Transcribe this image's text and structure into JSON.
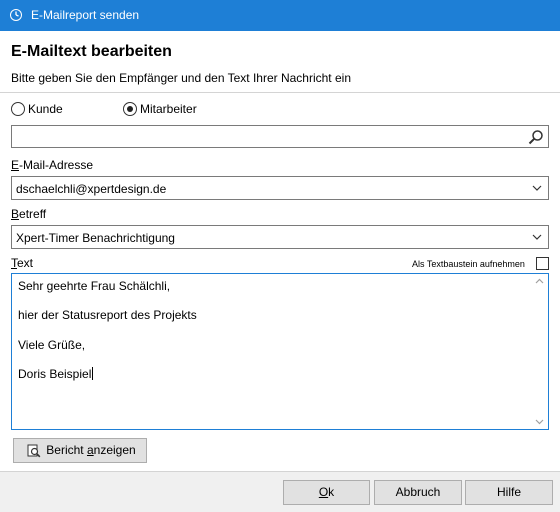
{
  "window": {
    "title": "E-Mailreport senden",
    "title_icon": "clock-icon"
  },
  "header": {
    "title": "E-Mailtext bearbeiten",
    "subtitle": "Bitte geben Sie den Empfänger und den Text Ihrer Nachricht ein"
  },
  "recipient_type": {
    "options": [
      {
        "label": "Kunde",
        "selected": false
      },
      {
        "label": "Mitarbeiter",
        "selected": true
      }
    ]
  },
  "search": {
    "value": "",
    "icon": "search-icon"
  },
  "email": {
    "label_accel": "E",
    "label_rest": "-Mail-Adresse",
    "value": "dschaelchli@xpertdesign.de"
  },
  "subject": {
    "label_accel": "B",
    "label_rest": "etreff",
    "value": "Xpert-Timer Benachrichtigung"
  },
  "body": {
    "label_accel": "T",
    "label_rest": "ext",
    "checkbox_label": "Als Textbaustein aufnehmen",
    "checkbox_checked": false,
    "lines": [
      "Sehr geehrte Frau Schälchli,",
      "hier der Statusreport des Projekts",
      "Viele Grüße,",
      "Doris Beispiel"
    ]
  },
  "report_button": {
    "label_pre": "Bericht ",
    "label_accel": "a",
    "label_post": "nzeigen",
    "icon": "report-magnifier-icon"
  },
  "footer": {
    "ok_accel": "O",
    "ok_rest": "k",
    "cancel": "Abbruch",
    "help": "Hilfe"
  },
  "colors": {
    "titlebar": "#1e7fd6",
    "button_bg": "#e1e1e1",
    "footer_bg": "#f0f0f0"
  }
}
